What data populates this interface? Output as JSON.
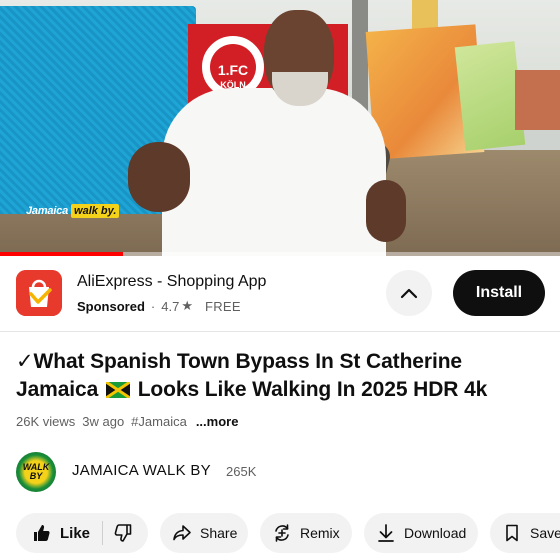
{
  "video": {
    "watermark_part1": "Jamaica",
    "watermark_part2": "walk by.",
    "banner_line1": "1.FC",
    "banner_line2": "KÖLN",
    "progress": 0.22
  },
  "ad": {
    "title": "AliExpress - Shopping App",
    "sponsored": "Sponsored",
    "separator": "·",
    "rating": "4.7",
    "star": "★",
    "price": "FREE",
    "install_label": "Install"
  },
  "title": {
    "line1": "✓What Spanish Town Bypass In St Catherine",
    "line2_a": "Jamaica",
    "line2_b": "Looks Like Walking In 2025 HDR 4k"
  },
  "meta": {
    "views": "26K views",
    "age": "3w ago",
    "hashtag": "#Jamaica",
    "more": "...more"
  },
  "channel": {
    "avatar_text": "WALK BY",
    "name": "JAMAICA WALK BY",
    "subscribers": "265K"
  },
  "actions": {
    "like": "Like",
    "share": "Share",
    "remix": "Remix",
    "download": "Download",
    "save": "Save"
  },
  "colors": {
    "accent_red": "#ff0000",
    "install_bg": "#0f0f0f",
    "chip_bg": "#f2f2f2",
    "aliexpress": "#e83a2c"
  }
}
